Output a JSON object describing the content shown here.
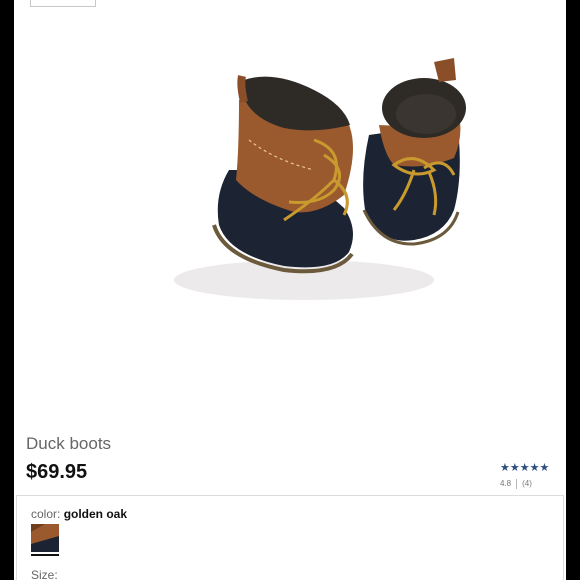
{
  "product": {
    "title": "Duck boots",
    "price": "$69.95",
    "image_alt": "child duck boots with golden laces"
  },
  "rating": {
    "stars": "★★★★★",
    "value": 4.8,
    "value_text": "4.8",
    "count_text": "(4)"
  },
  "options": {
    "color_label": "color:",
    "color_value": "golden oak",
    "size_label": "Size:"
  },
  "colors": {
    "star": "#2c4d80",
    "boot_rubber": "#1c2333",
    "boot_leather": "#9a5a2e",
    "lace": "#c99a2e"
  }
}
